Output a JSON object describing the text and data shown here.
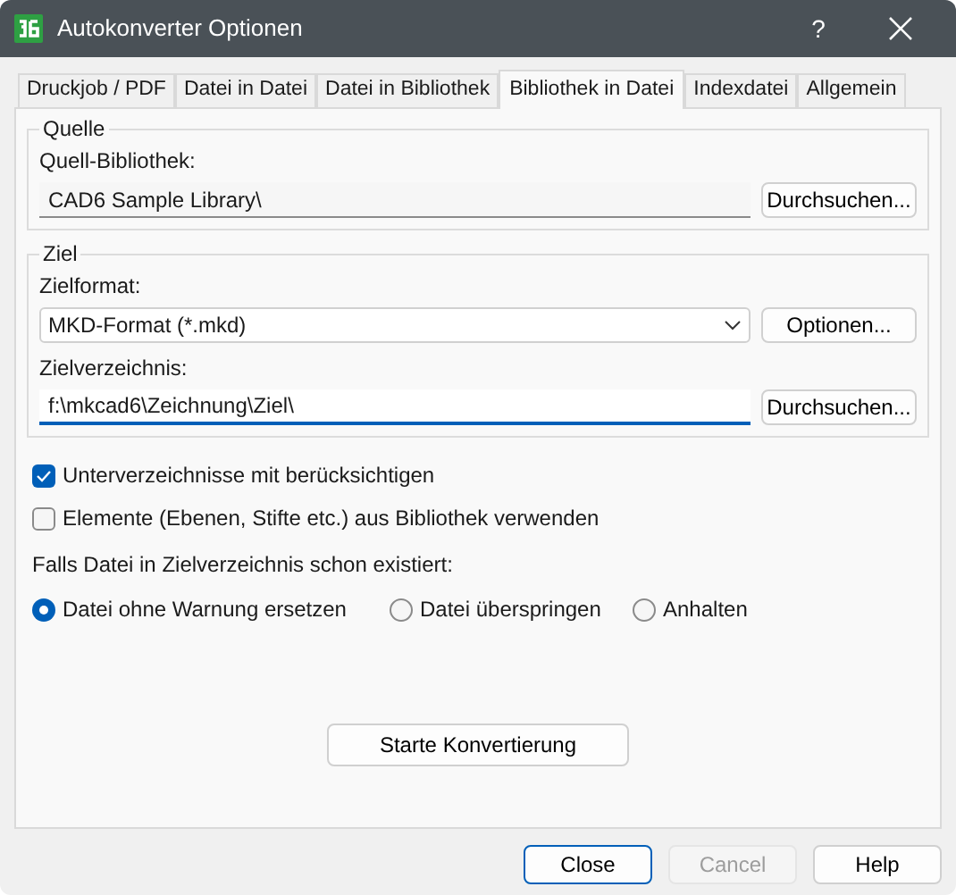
{
  "window": {
    "title": "Autokonverter Optionen",
    "help": "?"
  },
  "tabs": [
    {
      "label": "Druckjob / PDF",
      "selected": false
    },
    {
      "label": "Datei in Datei",
      "selected": false
    },
    {
      "label": "Datei in Bibliothek",
      "selected": false
    },
    {
      "label": "Bibliothek in Datei",
      "selected": true
    },
    {
      "label": "Indexdatei",
      "selected": false
    },
    {
      "label": "Allgemein",
      "selected": false
    }
  ],
  "quelle": {
    "title": "Quelle",
    "label": "Quell-Bibliothek:",
    "value": "CAD6 Sample Library\\",
    "button": "Durchsuchen..."
  },
  "ziel": {
    "title": "Ziel",
    "format_label": "Zielformat:",
    "format_value": "MKD-Format (*.mkd)",
    "format_button": "Optionen...",
    "dir_label": "Zielverzeichnis:",
    "dir_value": "f:\\mkcad6\\Zeichnung\\Ziel\\",
    "dir_button": "Durchsuchen..."
  },
  "checkboxes": [
    {
      "label": "Unterverzeichnisse mit berücksichtigen",
      "checked": true
    },
    {
      "label": "Elemente (Ebenen, Stifte etc.) aus Bibliothek verwenden",
      "checked": false
    }
  ],
  "exists_label": "Falls Datei in Zielverzeichnis schon existiert:",
  "radios": [
    {
      "label": "Datei ohne Warnung ersetzen",
      "selected": true
    },
    {
      "label": "Datei überspringen",
      "selected": false
    },
    {
      "label": "Anhalten",
      "selected": false
    }
  ],
  "start_button": "Starte Konvertierung",
  "buttons": [
    {
      "label": "Close",
      "disabled": false,
      "default": true
    },
    {
      "label": "Cancel",
      "disabled": true,
      "default": false
    },
    {
      "label": "Help",
      "disabled": false,
      "default": false
    }
  ]
}
